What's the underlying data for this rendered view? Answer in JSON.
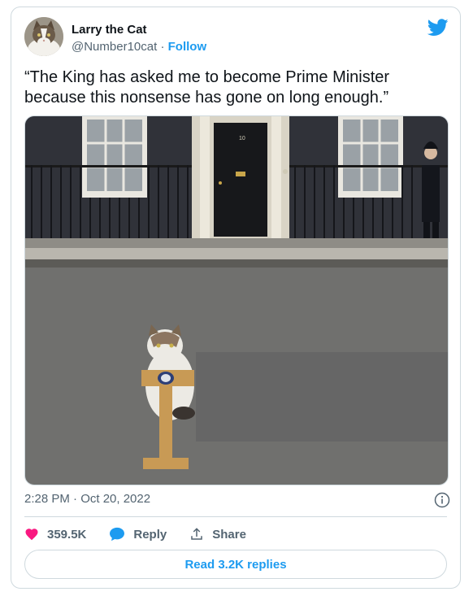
{
  "author": {
    "name": "Larry the Cat",
    "handle": "@Number10cat",
    "separator": "·",
    "follow_label": "Follow"
  },
  "tweet": {
    "text": "“The King has asked me to become Prime Minister because this nonsense has gone on long enough.”",
    "timestamp": "2:28 PM · Oct 20, 2022"
  },
  "media": {
    "door_number": "10"
  },
  "actions": {
    "likes_count": "359.5K",
    "reply_label": "Reply",
    "share_label": "Share",
    "read_replies_label": "Read 3.2K replies"
  },
  "colors": {
    "accent": "#1d9bf0",
    "like": "#f91880",
    "muted": "#536471",
    "border": "#cfd9de"
  },
  "icons": [
    "twitter-bird-icon",
    "info-icon",
    "heart-icon",
    "reply-bubble-icon",
    "share-icon"
  ]
}
